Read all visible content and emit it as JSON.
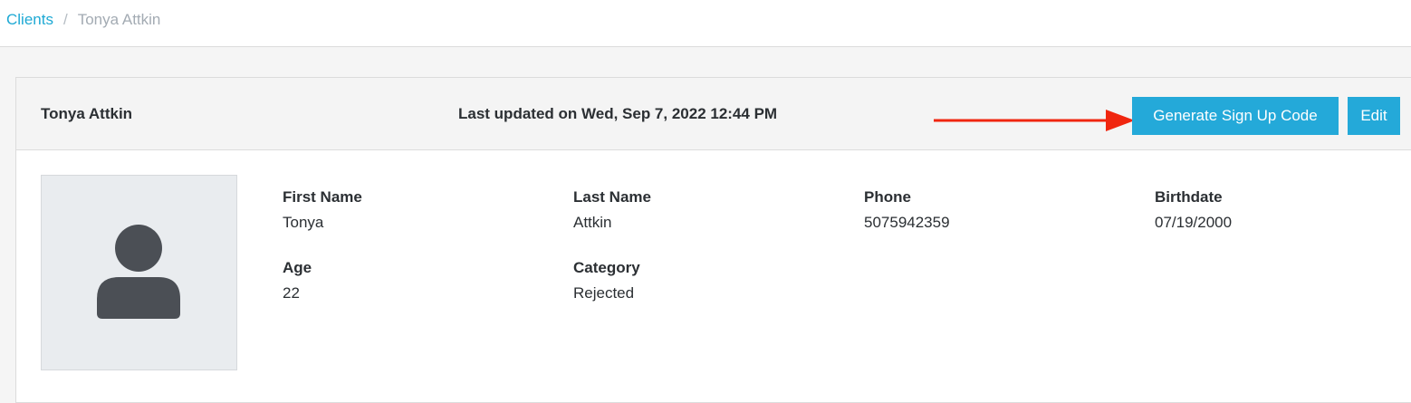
{
  "breadcrumb": {
    "parent": "Clients",
    "separator": "/",
    "current": "Tonya Attkin"
  },
  "header": {
    "client_name": "Tonya Attkin",
    "last_updated": "Last updated on Wed, Sep 7, 2022 12:44 PM",
    "generate_code_label": "Generate Sign Up Code",
    "edit_label": "Edit"
  },
  "annotation": {
    "arrow_color": "#f0260f"
  },
  "avatar": {
    "icon": "user-icon"
  },
  "fields": {
    "first_name": {
      "label": "First Name",
      "value": "Tonya"
    },
    "last_name": {
      "label": "Last Name",
      "value": "Attkin"
    },
    "phone": {
      "label": "Phone",
      "value": "5075942359"
    },
    "birthdate": {
      "label": "Birthdate",
      "value": "07/19/2000"
    },
    "age": {
      "label": "Age",
      "value": "22"
    },
    "category": {
      "label": "Category",
      "value": "Rejected"
    }
  },
  "colors": {
    "accent": "#24a9d9",
    "link": "#1ea9d4"
  }
}
